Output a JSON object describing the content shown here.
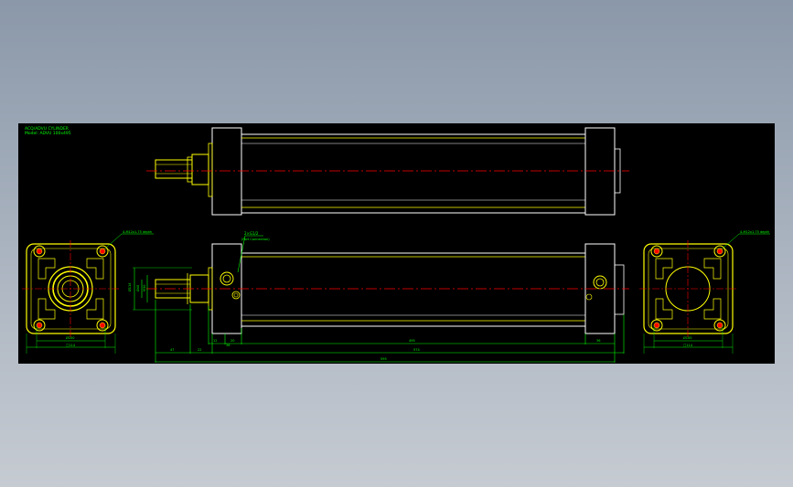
{
  "title_block": {
    "line1": "ACQ/ADVU CYLINDER",
    "line2": "Model: ADVU 100x495"
  },
  "annotations": {
    "left_flange_thread": "4-M12x1.75 depth",
    "right_flange_thread": "4-M12x1.75 depth",
    "port_note_line1": "2×G1/2",
    "port_note_line2": "(Port Connection)",
    "left_flange_inner_dim": "Ø100",
    "left_flange_outer_dim": "□114",
    "right_flange_inner_dim": "Ø100",
    "right_flange_outer_dim": "□114",
    "rod_dia_dim": "Ø40",
    "thread_dim": "M30",
    "bore_dim": "Ø114",
    "dim_a": "47",
    "dim_b": "22",
    "dim_c": "12",
    "dim_d": "20",
    "dim_e": "36",
    "dim_body": "495",
    "dim_f": "36",
    "dim_total_inner": "574",
    "dim_total": "595"
  },
  "colors": {
    "background": "#000000",
    "outline": "#ffffff",
    "highlight": "#ffff00",
    "dimension": "#00ff00",
    "centerline": "#ff0000"
  }
}
